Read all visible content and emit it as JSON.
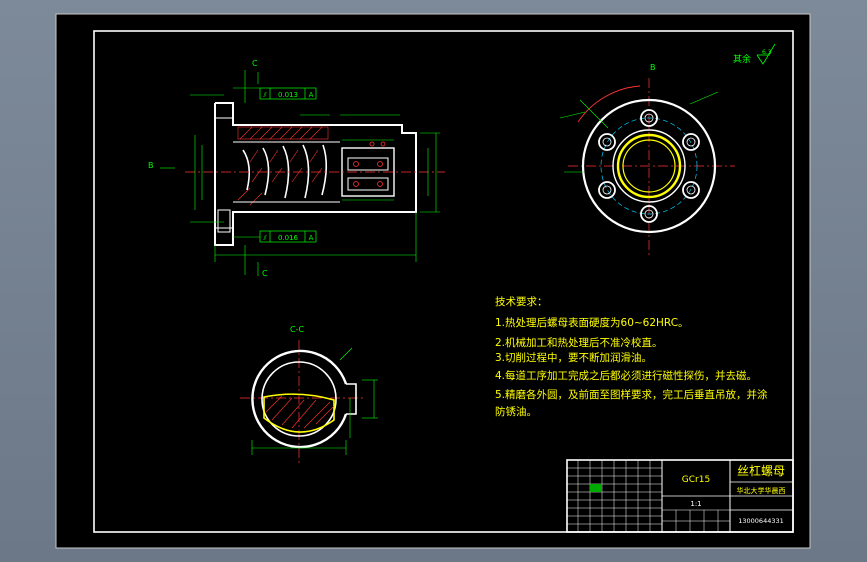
{
  "section_labels": {
    "cut_top": "C",
    "cut_bottom": "C",
    "view_b_left": "B",
    "view_b_top": "B",
    "section_cc": "C-C"
  },
  "tolerance_frames": [
    {
      "symbol": "⫽",
      "value": "0.013",
      "datum": "A"
    },
    {
      "symbol": "⫽",
      "value": "0.016",
      "datum": "A"
    }
  ],
  "roughness_note": {
    "label": "其余",
    "value": "6.3"
  },
  "technical_requirements": {
    "heading": "技术要求：",
    "items": [
      "1.热处理后螺母表面硬度为60~62HRC。",
      "2.机械加工和热处理后不准冷校直。",
      "3.切削过程中，要不断加润滑油。",
      "4.每道工序加工完成之后都必须进行磁性探伤，并去磁。",
      "5.精磨各外圆，及前面至图样要求，完工后垂直吊放，并涂",
      "防锈油。"
    ]
  },
  "title_block": {
    "material": "GCr15",
    "part_name": "丝杠螺母",
    "school": "华北大学华晨西",
    "scale": "1:1",
    "code": "13000644331"
  }
}
